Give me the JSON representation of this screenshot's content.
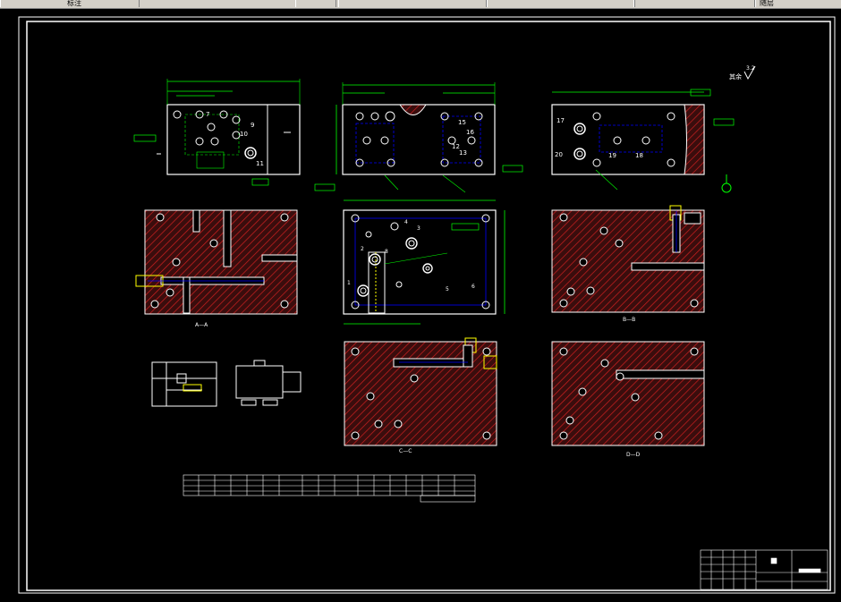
{
  "toolbar": {
    "left_label": "标注",
    "tabs": [
      "",
      "",
      "",
      ""
    ],
    "right_label": "随层"
  },
  "drawing": {
    "roughness_label": "其余",
    "roughness_value": "3.2",
    "view_labels": {
      "aa": "A—A",
      "bb": "B—B",
      "cc": "C—C",
      "dd": "D—D"
    },
    "feature_numbers_top_left": [
      "7",
      "10",
      "11",
      "9"
    ],
    "feature_numbers_top_mid": [
      "15",
      "16",
      "13",
      "12"
    ],
    "feature_numbers_top_right": [
      "17",
      "19",
      "18",
      "20"
    ],
    "feature_numbers_center": [
      "1",
      "2",
      "3",
      "4",
      "5",
      "6",
      "8"
    ]
  },
  "colors": {
    "frame": "#ffffff",
    "outline": "#ffffff",
    "dimension": "#00ff00",
    "centerline": "#0000ff",
    "hatch": "#ff2020",
    "section_fill": "#3a0d0d",
    "hidden": "#ffff00"
  }
}
